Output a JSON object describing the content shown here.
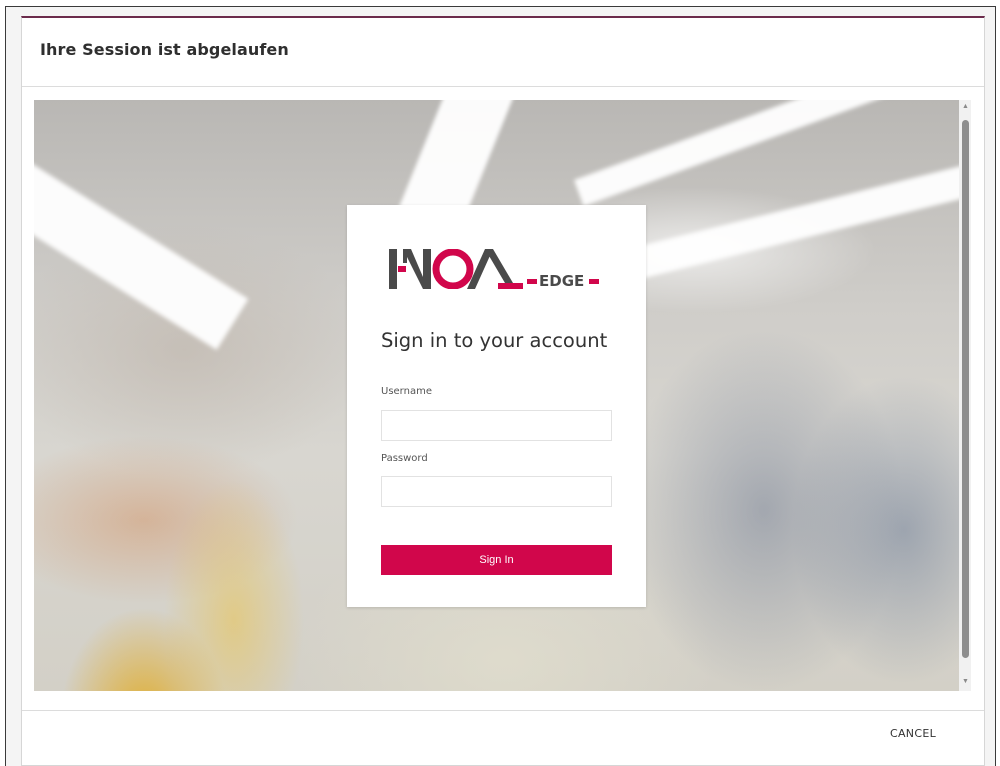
{
  "dialog": {
    "title": "Ihre Session ist abgelaufen",
    "cancel_label": "CANCEL"
  },
  "login": {
    "logo_text": "NOA",
    "logo_suffix": "EDGE",
    "heading": "Sign in to your account",
    "username_label": "Username",
    "username_value": "",
    "password_label": "Password",
    "password_value": "",
    "submit_label": "Sign In"
  },
  "colors": {
    "brand_red": "#d1064b",
    "logo_gray": "#4a4a4a",
    "dialog_accent": "#6b2b4b"
  },
  "icons": [
    "scroll-up-arrow-icon",
    "scroll-down-arrow-icon"
  ]
}
